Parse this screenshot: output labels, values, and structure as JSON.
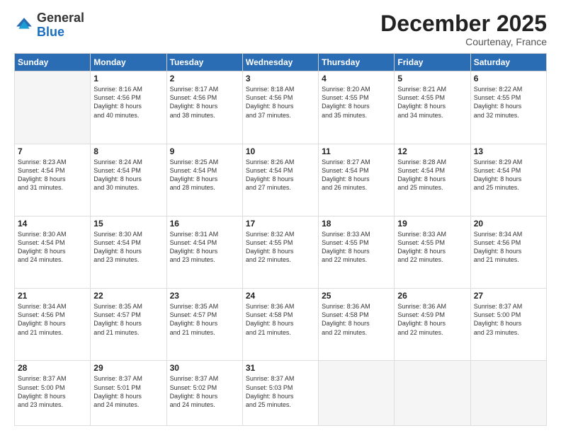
{
  "logo": {
    "general": "General",
    "blue": "Blue"
  },
  "header": {
    "month": "December 2025",
    "location": "Courtenay, France"
  },
  "weekdays": [
    "Sunday",
    "Monday",
    "Tuesday",
    "Wednesday",
    "Thursday",
    "Friday",
    "Saturday"
  ],
  "weeks": [
    [
      {
        "day": "",
        "detail": ""
      },
      {
        "day": "1",
        "detail": "Sunrise: 8:16 AM\nSunset: 4:56 PM\nDaylight: 8 hours\nand 40 minutes."
      },
      {
        "day": "2",
        "detail": "Sunrise: 8:17 AM\nSunset: 4:56 PM\nDaylight: 8 hours\nand 38 minutes."
      },
      {
        "day": "3",
        "detail": "Sunrise: 8:18 AM\nSunset: 4:56 PM\nDaylight: 8 hours\nand 37 minutes."
      },
      {
        "day": "4",
        "detail": "Sunrise: 8:20 AM\nSunset: 4:55 PM\nDaylight: 8 hours\nand 35 minutes."
      },
      {
        "day": "5",
        "detail": "Sunrise: 8:21 AM\nSunset: 4:55 PM\nDaylight: 8 hours\nand 34 minutes."
      },
      {
        "day": "6",
        "detail": "Sunrise: 8:22 AM\nSunset: 4:55 PM\nDaylight: 8 hours\nand 32 minutes."
      }
    ],
    [
      {
        "day": "7",
        "detail": "Sunrise: 8:23 AM\nSunset: 4:54 PM\nDaylight: 8 hours\nand 31 minutes."
      },
      {
        "day": "8",
        "detail": "Sunrise: 8:24 AM\nSunset: 4:54 PM\nDaylight: 8 hours\nand 30 minutes."
      },
      {
        "day": "9",
        "detail": "Sunrise: 8:25 AM\nSunset: 4:54 PM\nDaylight: 8 hours\nand 28 minutes."
      },
      {
        "day": "10",
        "detail": "Sunrise: 8:26 AM\nSunset: 4:54 PM\nDaylight: 8 hours\nand 27 minutes."
      },
      {
        "day": "11",
        "detail": "Sunrise: 8:27 AM\nSunset: 4:54 PM\nDaylight: 8 hours\nand 26 minutes."
      },
      {
        "day": "12",
        "detail": "Sunrise: 8:28 AM\nSunset: 4:54 PM\nDaylight: 8 hours\nand 25 minutes."
      },
      {
        "day": "13",
        "detail": "Sunrise: 8:29 AM\nSunset: 4:54 PM\nDaylight: 8 hours\nand 25 minutes."
      }
    ],
    [
      {
        "day": "14",
        "detail": "Sunrise: 8:30 AM\nSunset: 4:54 PM\nDaylight: 8 hours\nand 24 minutes."
      },
      {
        "day": "15",
        "detail": "Sunrise: 8:30 AM\nSunset: 4:54 PM\nDaylight: 8 hours\nand 23 minutes."
      },
      {
        "day": "16",
        "detail": "Sunrise: 8:31 AM\nSunset: 4:54 PM\nDaylight: 8 hours\nand 23 minutes."
      },
      {
        "day": "17",
        "detail": "Sunrise: 8:32 AM\nSunset: 4:55 PM\nDaylight: 8 hours\nand 22 minutes."
      },
      {
        "day": "18",
        "detail": "Sunrise: 8:33 AM\nSunset: 4:55 PM\nDaylight: 8 hours\nand 22 minutes."
      },
      {
        "day": "19",
        "detail": "Sunrise: 8:33 AM\nSunset: 4:55 PM\nDaylight: 8 hours\nand 22 minutes."
      },
      {
        "day": "20",
        "detail": "Sunrise: 8:34 AM\nSunset: 4:56 PM\nDaylight: 8 hours\nand 21 minutes."
      }
    ],
    [
      {
        "day": "21",
        "detail": "Sunrise: 8:34 AM\nSunset: 4:56 PM\nDaylight: 8 hours\nand 21 minutes."
      },
      {
        "day": "22",
        "detail": "Sunrise: 8:35 AM\nSunset: 4:57 PM\nDaylight: 8 hours\nand 21 minutes."
      },
      {
        "day": "23",
        "detail": "Sunrise: 8:35 AM\nSunset: 4:57 PM\nDaylight: 8 hours\nand 21 minutes."
      },
      {
        "day": "24",
        "detail": "Sunrise: 8:36 AM\nSunset: 4:58 PM\nDaylight: 8 hours\nand 21 minutes."
      },
      {
        "day": "25",
        "detail": "Sunrise: 8:36 AM\nSunset: 4:58 PM\nDaylight: 8 hours\nand 22 minutes."
      },
      {
        "day": "26",
        "detail": "Sunrise: 8:36 AM\nSunset: 4:59 PM\nDaylight: 8 hours\nand 22 minutes."
      },
      {
        "day": "27",
        "detail": "Sunrise: 8:37 AM\nSunset: 5:00 PM\nDaylight: 8 hours\nand 23 minutes."
      }
    ],
    [
      {
        "day": "28",
        "detail": "Sunrise: 8:37 AM\nSunset: 5:00 PM\nDaylight: 8 hours\nand 23 minutes."
      },
      {
        "day": "29",
        "detail": "Sunrise: 8:37 AM\nSunset: 5:01 PM\nDaylight: 8 hours\nand 24 minutes."
      },
      {
        "day": "30",
        "detail": "Sunrise: 8:37 AM\nSunset: 5:02 PM\nDaylight: 8 hours\nand 24 minutes."
      },
      {
        "day": "31",
        "detail": "Sunrise: 8:37 AM\nSunset: 5:03 PM\nDaylight: 8 hours\nand 25 minutes."
      },
      {
        "day": "",
        "detail": ""
      },
      {
        "day": "",
        "detail": ""
      },
      {
        "day": "",
        "detail": ""
      }
    ]
  ]
}
